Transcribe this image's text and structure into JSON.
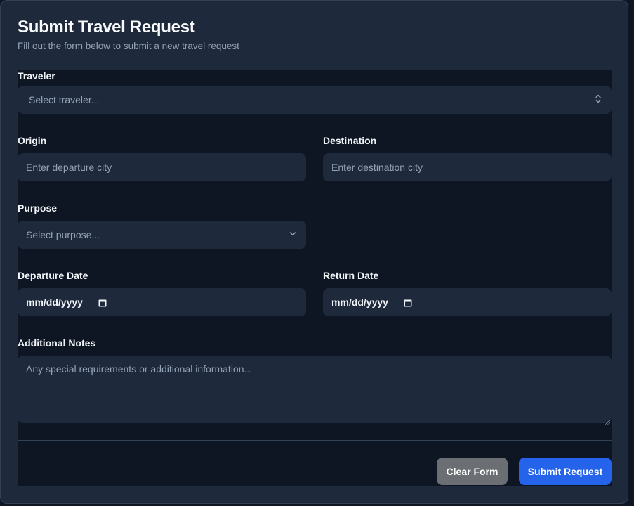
{
  "header": {
    "title": "Submit Travel Request",
    "subtitle": "Fill out the form below to submit a new travel request"
  },
  "form": {
    "traveler": {
      "label": "Traveler",
      "placeholder": "Select traveler..."
    },
    "origin": {
      "label": "Origin",
      "placeholder": "Enter departure city"
    },
    "destination": {
      "label": "Destination",
      "placeholder": "Enter destination city"
    },
    "purpose": {
      "label": "Purpose",
      "placeholder": "Select purpose..."
    },
    "departure_date": {
      "label": "Departure Date",
      "value": "mm/dd/yyyy"
    },
    "return_date": {
      "label": "Return Date",
      "value": "mm/dd/yyyy"
    },
    "notes": {
      "label": "Additional Notes",
      "placeholder": "Any special requirements or additional information..."
    }
  },
  "actions": {
    "clear_label": "Clear Form",
    "submit_label": "Submit Request"
  },
  "icons": {
    "traveler_select": "chevron-up-down-icon",
    "purpose_select": "chevron-down-icon",
    "date_picker": "calendar-icon"
  },
  "colors": {
    "card_bg": "#1e293b",
    "form_bg": "#0f1623",
    "accent": "#2563eb",
    "secondary_button": "#6b6f74",
    "placeholder": "#94a3b8"
  }
}
